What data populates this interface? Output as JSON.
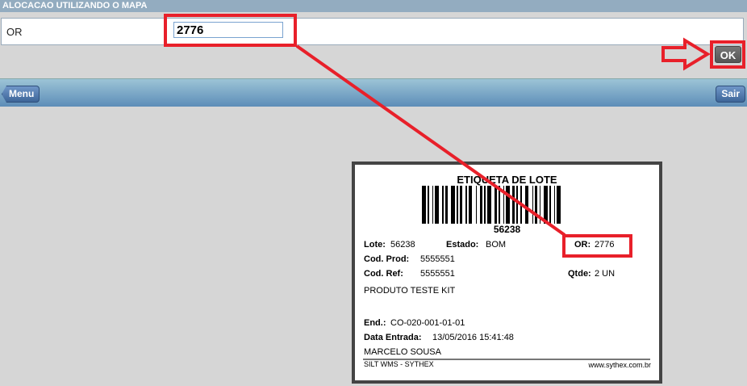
{
  "header": {
    "title": "ALOCACAO UTILIZANDO O MAPA"
  },
  "form": {
    "field_label": "OR",
    "field_value": "2776",
    "ok_label": "OK"
  },
  "nav": {
    "menu_label": "Menu",
    "exit_label": "Sair"
  },
  "label_preview": {
    "title": "ETIQUETA DE LOTE",
    "barcode_number": "56238",
    "lote_label": "Lote:",
    "lote": "56238",
    "estado_label": "Estado:",
    "estado": "BOM",
    "or_label": "OR:",
    "or": "2776",
    "cod_prod_label": "Cod. Prod:",
    "cod_prod": "5555551",
    "cod_ref_label": "Cod. Ref:",
    "cod_ref": "5555551",
    "qtde_label": "Qtde:",
    "qtde": "2 UN",
    "product": "PRODUTO TESTE KIT",
    "end_label": "End.:",
    "end": "CO-020-001-01-01",
    "data_label": "Data Entrada:",
    "data": "13/05/2016 15:41:48",
    "user": "MARCELO SOUSA",
    "footer_left": "SILT WMS - SYTHEX",
    "footer_right": "www.sythex.com.br"
  },
  "annotation_color": "#e8202a"
}
